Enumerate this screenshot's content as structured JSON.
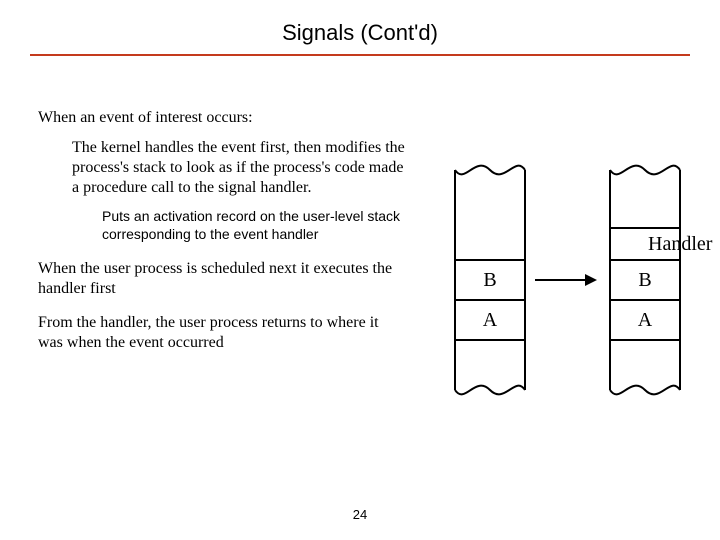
{
  "title": "Signals (Cont'd)",
  "intro": "When an event of interest occurs:",
  "para1": "The kernel handles the event first, then modifies the process's stack to look as if the process's code made a procedure call to the signal handler.",
  "note": "Puts an activation record on the user-level stack corresponding to the event handler",
  "para2": "When the user process is scheduled next it executes the handler first",
  "para3": "From the handler, the user process returns to where it was when the event occurred",
  "pagenum": "24",
  "diagram": {
    "handler_label": "Handler",
    "left_top": "B",
    "left_bottom": "A",
    "right_top": "B",
    "right_bottom": "A"
  }
}
